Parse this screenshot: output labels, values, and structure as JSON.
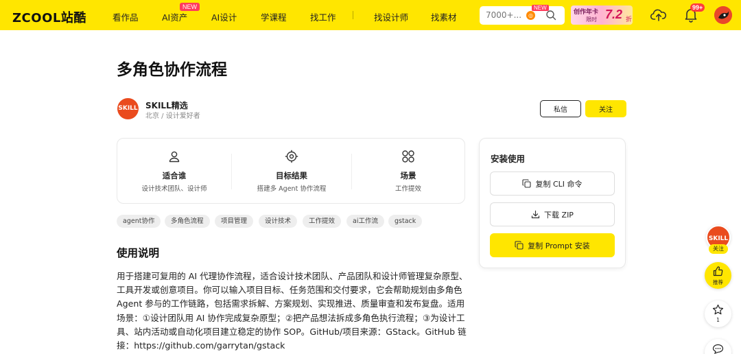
{
  "nav": {
    "logo": "ZCOOL站酷",
    "items": [
      "看作品",
      "AI资产",
      "AI设计",
      "学课程",
      "找工作",
      "找设计师",
      "找素材"
    ],
    "new_badge": "NEW",
    "search_placeholder": "7000+...",
    "search_new_badge": "NEW",
    "promo_title": "创作年卡",
    "promo_sub": "限时",
    "promo_price": "7.2",
    "promo_unit": "折",
    "notification_count": "99+"
  },
  "page": {
    "title": "多角色协作流程"
  },
  "author": {
    "avatar_text": "SKILL",
    "name": "SKILL精选",
    "meta": "北京 / 设计爱好者",
    "message_label": "私信",
    "follow_label": "关注"
  },
  "info": [
    {
      "icon": "user-icon",
      "title": "适合谁",
      "sub": "设计技术团队、设计师"
    },
    {
      "icon": "target-icon",
      "title": "目标结果",
      "sub": "搭建多 Agent 协作流程"
    },
    {
      "icon": "grid-icon",
      "title": "场景",
      "sub": "工作提效"
    }
  ],
  "tags": [
    "agent协作",
    "多角色流程",
    "项目管理",
    "设计技术",
    "工作提效",
    "ai工作流",
    "gstack"
  ],
  "usage": {
    "title": "使用说明",
    "text": "用于搭建可复用的 AI 代理协作流程，适合设计技术团队、产品团队和设计师管理复杂原型、工具开发或创意项目。你可以输入项目目标、任务范围和交付要求，它会帮助规划由多角色 Agent 参与的工作链路，包括需求拆解、方案规划、实现推进、质量审查和发布复盘。适用场景：①设计团队用 AI 协作完成复杂原型；②把产品想法拆成多角色执行流程；③为设计工具、站内活动或自动化项目建立稳定的协作 SOP。GitHub/项目来源：GStack。GitHub 链接：https://github.com/garrytan/gstack"
  },
  "install": {
    "title": "安装使用",
    "copy_cli": "复制 CLI 命令",
    "download_zip": "下载 ZIP",
    "copy_prompt": "复制 Prompt 安装"
  },
  "floating": {
    "skill_avatar": "SKILL",
    "follow": "关注",
    "recommend": "推荐",
    "star_count": "1"
  },
  "colors": {
    "brand_yellow": "#FFE600",
    "accent_red": "#ea4b1e"
  }
}
